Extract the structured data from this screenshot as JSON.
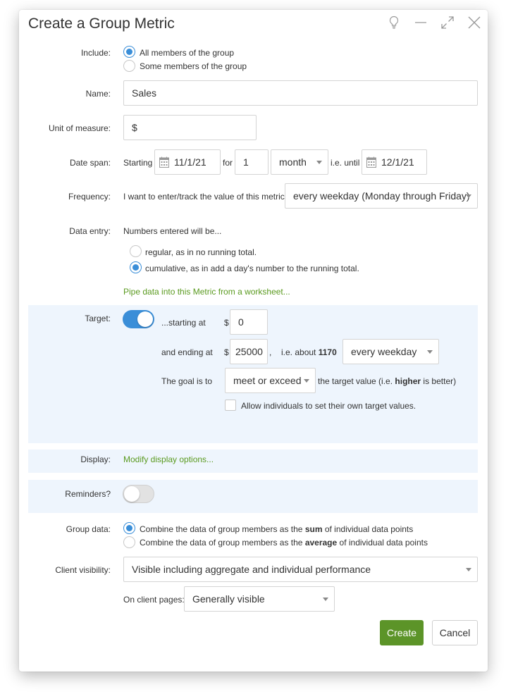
{
  "dialog": {
    "title": "Create a Group Metric"
  },
  "header_icons": [
    "lightbulb-icon",
    "minimize-icon",
    "expand-icon",
    "close-icon"
  ],
  "include": {
    "label": "Include:",
    "options": [
      "All members of the group",
      "Some members of the group"
    ],
    "selected": 0
  },
  "name": {
    "label": "Name:",
    "value": "Sales"
  },
  "unit": {
    "label": "Unit of measure:",
    "value": "$"
  },
  "date_span": {
    "label": "Date span:",
    "starting_text": "Starting",
    "start_date": "11/1/21",
    "for_text": "for",
    "count": "1",
    "period": "month",
    "until_text": "i.e. until",
    "end_date": "12/1/21"
  },
  "frequency": {
    "label": "Frequency:",
    "text": "I want to enter/track the value of this metric",
    "value": "every weekday (Monday through Friday)"
  },
  "data_entry": {
    "label": "Data entry:",
    "intro": "Numbers entered will be...",
    "options": [
      "regular, as in no running total.",
      "cumulative, as in add a day's number to the running total."
    ],
    "selected": 1,
    "pipe_link": "Pipe data into this Metric from a worksheet..."
  },
  "target": {
    "label": "Target:",
    "enabled": true,
    "starting_text": "...starting at",
    "currency": "$",
    "start_value": "0",
    "ending_text": "and ending at",
    "end_value": "25000",
    "comma": ",",
    "about_text": "i.e. about",
    "about_value": "1170",
    "about_period": "every weekday",
    "goal_text": "The goal is to",
    "goal_value": "meet or exceed",
    "goal_suffix_pre": "the target value (i.e.",
    "goal_suffix_bold": "higher",
    "goal_suffix_post": "is better)",
    "allow_individuals": "Allow individuals to set their own target values.",
    "allow_checked": false
  },
  "display": {
    "label": "Display:",
    "link": "Modify display options..."
  },
  "reminders": {
    "label": "Reminders?",
    "enabled": false
  },
  "group_data": {
    "label": "Group data:",
    "option1_pre": "Combine the data of group members as the",
    "option1_bold": "sum",
    "option1_post": "of individual data points",
    "option2_pre": "Combine the data of group members as the",
    "option2_bold": "average",
    "option2_post": "of individual data points",
    "selected": 0
  },
  "client_visibility": {
    "label": "Client visibility:",
    "value": "Visible including aggregate and individual performance",
    "pages_label": "On client pages:",
    "pages_value": "Generally visible"
  },
  "actions": {
    "create": "Create",
    "cancel": "Cancel"
  },
  "colors": {
    "accent_blue": "#3a8ed8",
    "link_green": "#5a9a1f",
    "create_green": "#5c9428",
    "panel_bg": "#eef5fd"
  }
}
